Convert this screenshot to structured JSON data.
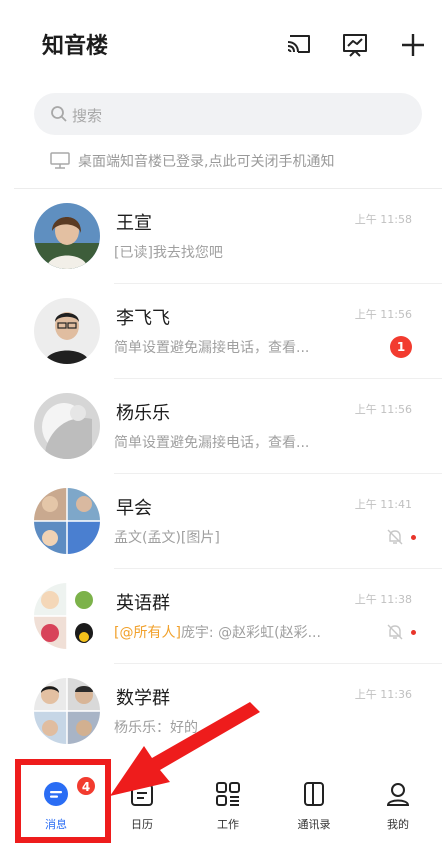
{
  "header": {
    "title": "知音楼",
    "icons": [
      "cast-screen-icon",
      "chart-board-icon",
      "plus-icon"
    ]
  },
  "search": {
    "placeholder": "搜索"
  },
  "notice": {
    "text": "桌面端知音楼已登录,点此可关闭手机通知"
  },
  "conversations": [
    {
      "name": "王宣",
      "preview": "[已读]我去找您吧",
      "time": "上午 11:58"
    },
    {
      "name": "李飞飞",
      "preview": "简单设置避免漏接电话，查看...",
      "time": "上午 11:56",
      "unread": "1"
    },
    {
      "name": "杨乐乐",
      "preview": "简单设置避免漏接电话，查看...",
      "time": "上午 11:56"
    },
    {
      "name": "早会",
      "preview": "孟文(孟文)[图片]",
      "time": "上午 11:41",
      "muted": true
    },
    {
      "name": "英语群",
      "mention": "[@所有人]",
      "preview": "庞宇: @赵彩虹(赵彩...",
      "time": "上午 11:38",
      "muted": true
    },
    {
      "name": "数学群",
      "preview": "杨乐乐：好的",
      "time": "上午 11:36"
    }
  ],
  "tabbar": {
    "tabs": [
      {
        "label": "消息",
        "active": true,
        "badge": "4"
      },
      {
        "label": "日历"
      },
      {
        "label": "工作"
      },
      {
        "label": "通讯录"
      },
      {
        "label": "我的"
      }
    ]
  },
  "colors": {
    "accent": "#2a6df4",
    "badge": "#f23b2f",
    "annotation": "#ee1c1c",
    "mention": "#f1a12c"
  }
}
